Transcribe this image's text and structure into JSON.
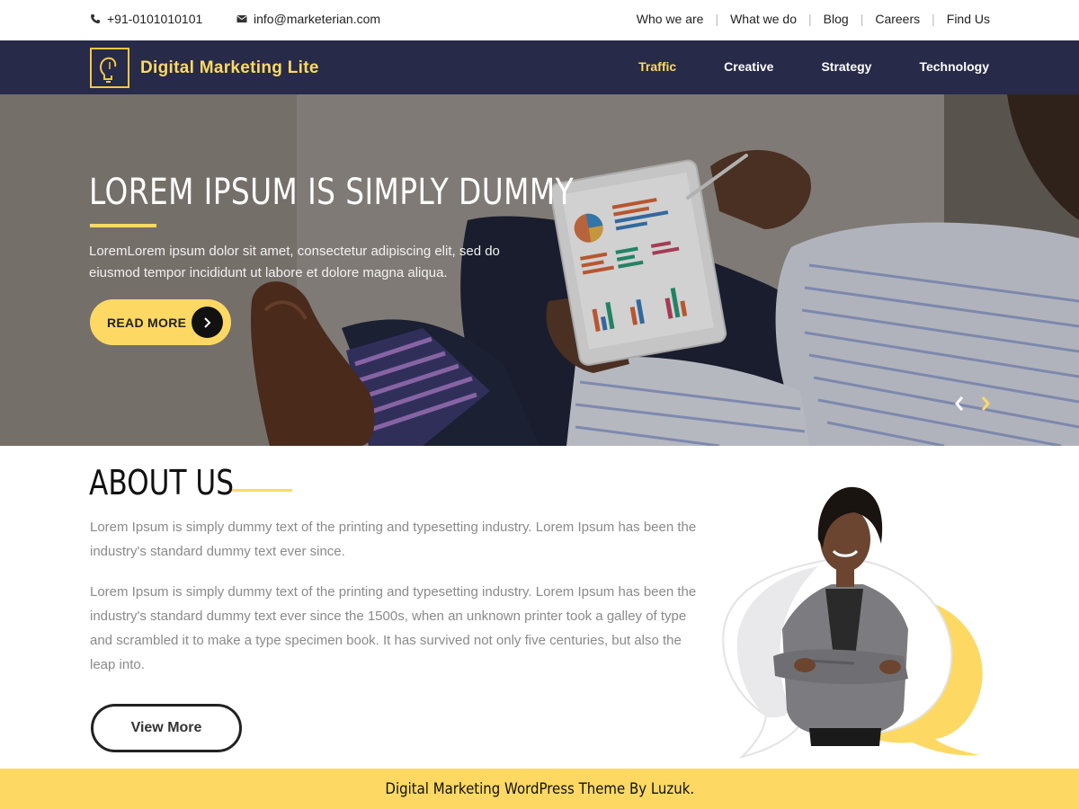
{
  "topbar": {
    "phone": "+91-0101010101",
    "email": "info@marketerian.com",
    "links": [
      "Who we are",
      "What we do",
      "Blog",
      "Careers",
      "Find Us"
    ]
  },
  "navbar": {
    "site_title": "Digital Marketing Lite",
    "items": [
      {
        "label": "Traffic",
        "active": true
      },
      {
        "label": "Creative",
        "active": false
      },
      {
        "label": "Strategy",
        "active": false
      },
      {
        "label": "Technology",
        "active": false
      }
    ]
  },
  "hero": {
    "title": "LOREM IPSUM IS SIMPLY DUMMY",
    "description": "LoremLorem ipsum dolor sit amet, consectetur adipiscing elit, sed do eiusmod tempor incididunt ut labore et dolore magna aliqua.",
    "button_label": "READ MORE"
  },
  "about": {
    "title": "ABOUT US",
    "paragraph1": "Lorem Ipsum is simply dummy text of the printing and typesetting industry. Lorem Ipsum has been the industry's standard dummy text ever since.",
    "paragraph2": "Lorem Ipsum is simply dummy text of the printing and typesetting industry. Lorem Ipsum has been the industry's standard dummy text ever since the 1500s, when an unknown printer took a galley of type and scrambled it to make a type specimen book. It has survived not only five centuries, but also the leap into.",
    "button_label": "View More"
  },
  "footer": {
    "credit": "Digital Marketing WordPress Theme By Luzuk."
  },
  "colors": {
    "accent": "#fdd964",
    "navbar": "#272a48"
  },
  "icons": {
    "phone": "phone-icon",
    "email": "envelope-icon",
    "logo": "lightbulb-icon",
    "read_more": "chevron-right-icon",
    "slider_prev": "chevron-left-icon",
    "slider_next": "chevron-right-icon"
  }
}
